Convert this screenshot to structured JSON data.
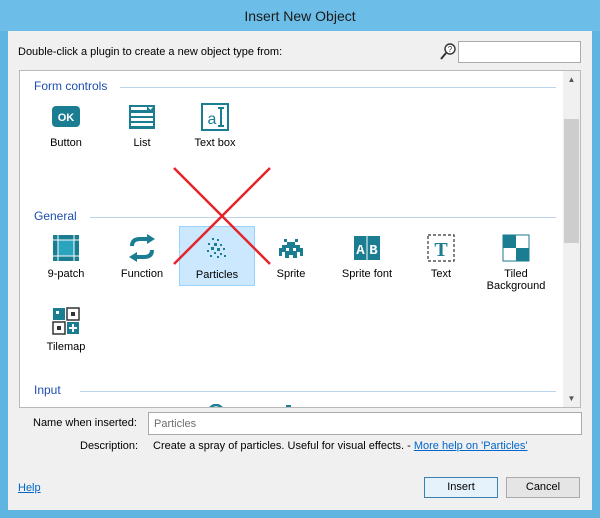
{
  "window": {
    "title": "Insert New Object"
  },
  "search": {
    "prompt": "Double-click a plugin to create a new object type from:",
    "value": "",
    "icon": "search-help-icon"
  },
  "groups": [
    {
      "name": "Form controls",
      "items": [
        {
          "label": "Button",
          "icon": "button-ok-icon"
        },
        {
          "label": "List",
          "icon": "list-icon"
        },
        {
          "label": "Text box",
          "icon": "textbox-icon"
        }
      ]
    },
    {
      "name": "General",
      "items": [
        {
          "label": "9-patch",
          "icon": "ninepatch-icon"
        },
        {
          "label": "Function",
          "icon": "function-icon"
        },
        {
          "label": "Particles",
          "icon": "particles-icon",
          "selected": true,
          "crossed_out": true
        },
        {
          "label": "Sprite",
          "icon": "sprite-invader-icon"
        },
        {
          "label": "Sprite font",
          "icon": "sprite-font-icon"
        },
        {
          "label": "Text",
          "icon": "text-t-icon"
        },
        {
          "label": "Tiled\nBackground",
          "icon": "tiled-background-icon"
        },
        {
          "label": "Tilemap",
          "icon": "tilemap-icon"
        }
      ]
    },
    {
      "name": "Input",
      "items": [
        {
          "label": "",
          "icon": "gamepad-icon"
        },
        {
          "label": "",
          "icon": "keyboard-icon"
        },
        {
          "label": "",
          "icon": "mouse-icon"
        },
        {
          "label": "",
          "icon": "touch-hand-icon"
        }
      ]
    }
  ],
  "name_field": {
    "label": "Name when inserted:",
    "value": "Particles"
  },
  "description": {
    "label": "Description:",
    "text": "Create a spray of particles.  Useful for visual effects. - ",
    "link": "More help on 'Particles'"
  },
  "footer": {
    "help": "Help",
    "insert": "Insert",
    "cancel": "Cancel"
  },
  "colors": {
    "accent": "#1b7d92",
    "title_bar": "#6cbde8",
    "group_header": "#1d4fb0",
    "cross": "#e3242b"
  }
}
